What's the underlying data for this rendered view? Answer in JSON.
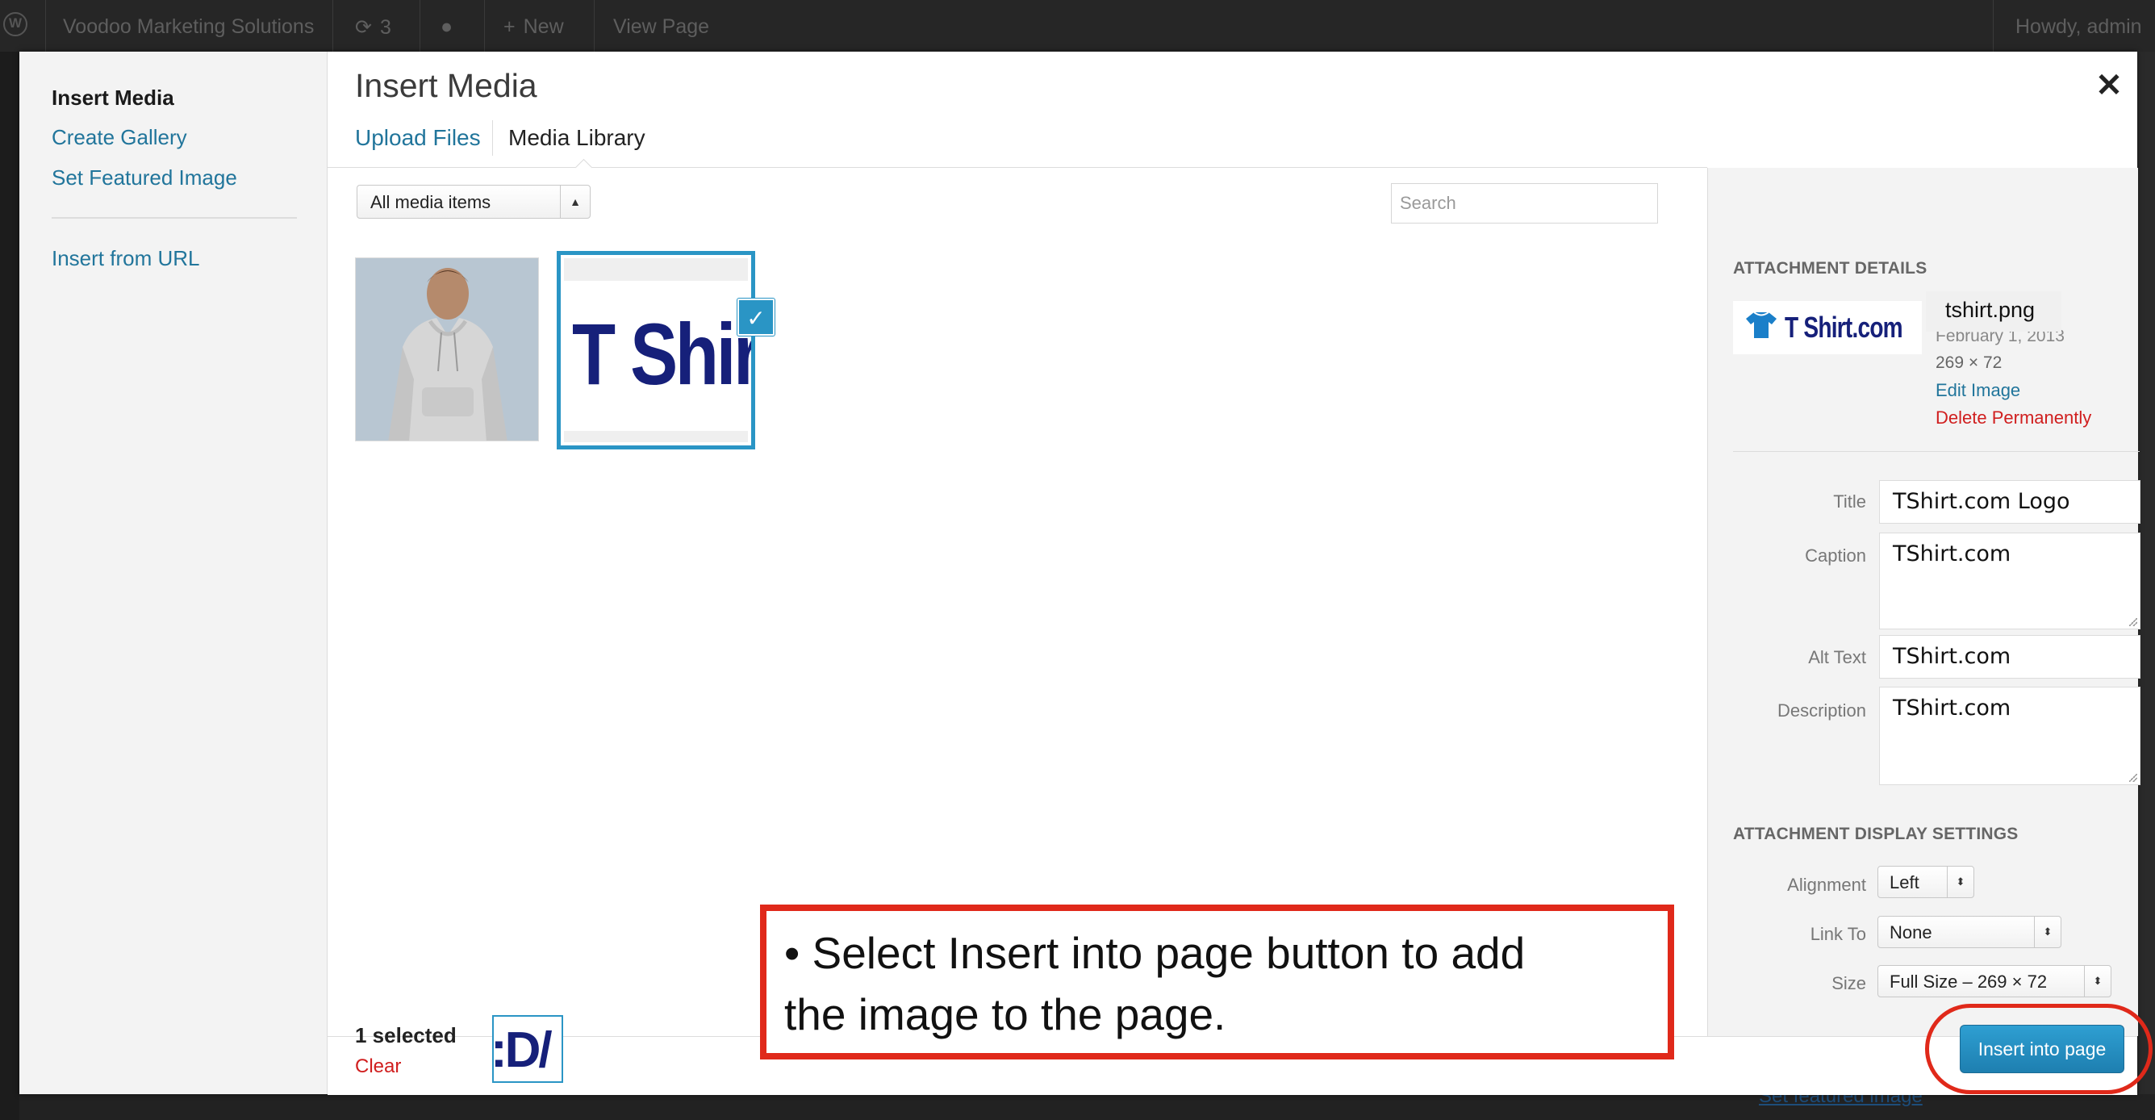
{
  "admin_bar": {
    "site_name": "Voodoo Marketing Solutions",
    "updates_count": "3",
    "new_label": "New",
    "view_page_label": "View Page",
    "howdy": "Howdy, admin"
  },
  "background": {
    "set_featured_image_link": "Set featured image"
  },
  "media_menu": {
    "items": [
      {
        "label": "Insert Media"
      },
      {
        "label": "Create Gallery"
      },
      {
        "label": "Set Featured Image"
      },
      {
        "label": "Insert from URL"
      }
    ]
  },
  "frame": {
    "title": "Insert Media",
    "close_icon": "close-icon",
    "tabs": [
      {
        "label": "Upload Files"
      },
      {
        "label": "Media Library"
      }
    ]
  },
  "toolbar": {
    "filter_value": "All media items",
    "search_placeholder": "Search"
  },
  "attachments": [
    {
      "name": "hoodie-photo",
      "selected": false
    },
    {
      "name": "tshirt-logo",
      "text": "T Shir",
      "selected": true
    }
  ],
  "attachment_details": {
    "heading": "ATTACHMENT DETAILS",
    "thumb_text": "T Shirt.com",
    "filename": "tshirt.png",
    "date": "February 1, 2013",
    "dimensions": "269 × 72",
    "edit_link": "Edit Image",
    "delete_link": "Delete Permanently",
    "fields": {
      "title_label": "Title",
      "title_value": "TShirt.com Logo",
      "caption_label": "Caption",
      "caption_value": "TShirt.com",
      "alt_label": "Alt Text",
      "alt_value": "TShirt.com",
      "description_label": "Description",
      "description_value": "TShirt.com"
    }
  },
  "display_settings": {
    "heading": "ATTACHMENT DISPLAY SETTINGS",
    "alignment_label": "Alignment",
    "alignment_value": "Left",
    "link_to_label": "Link To",
    "link_to_value": "None",
    "size_label": "Size",
    "size_value": "Full Size – 269 × 72"
  },
  "footer": {
    "selected_count": "1 selected",
    "clear_label": "Clear",
    "mini_thumb_text": ":D/",
    "insert_button": "Insert into page"
  },
  "callout": {
    "line1": "• Select Insert into page button to add",
    "line2": "the image to the page."
  },
  "colors": {
    "accent_blue": "#2a95c5",
    "link_blue": "#21759b",
    "delete_red": "#d01e1e",
    "annotation_red": "#e0291a",
    "logo_navy": "#16207a"
  }
}
